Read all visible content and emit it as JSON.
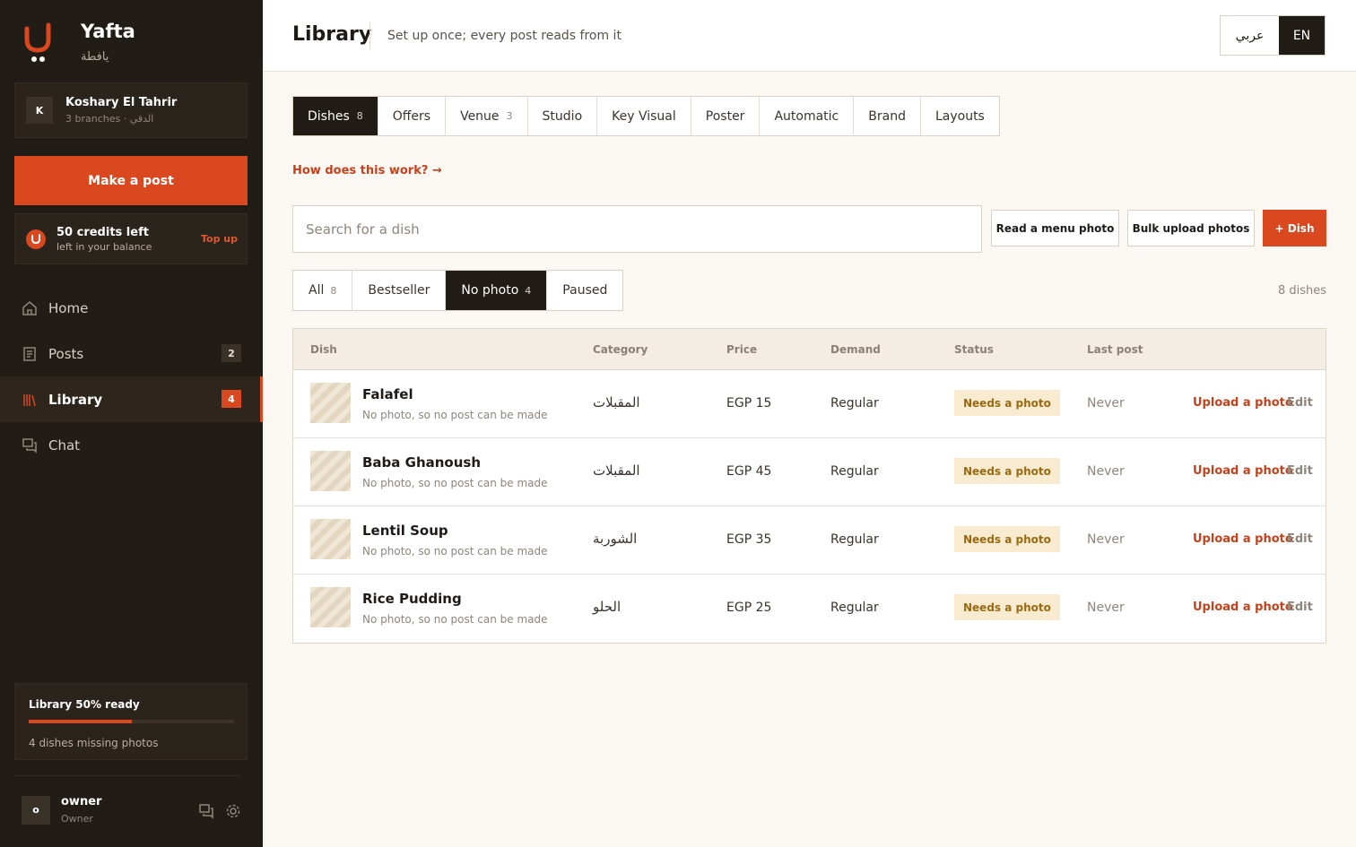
{
  "brand": {
    "name": "Yafta",
    "name_ar": "يافطة"
  },
  "org": {
    "initial": "K",
    "name": "Koshary El Tahrir",
    "sub": "3 branches · الدقي"
  },
  "sidebar": {
    "make_post": "Make a post",
    "credits": {
      "title": "50 credits left",
      "sub": "left in your balance",
      "topup": "Top up"
    },
    "nav": [
      {
        "label": "Home",
        "icon": "home-icon",
        "badge": ""
      },
      {
        "label": "Posts",
        "icon": "posts-icon",
        "badge": "2"
      },
      {
        "label": "Library",
        "icon": "library-icon",
        "badge": "4",
        "active": true
      },
      {
        "label": "Chat",
        "icon": "chat-icon",
        "badge": ""
      }
    ],
    "progress": {
      "title": "Library 50% ready",
      "fraction": 0.5,
      "sub": "4 dishes missing photos"
    },
    "user": {
      "initial": "o",
      "name": "owner",
      "role": "Owner"
    }
  },
  "header": {
    "title": "Library",
    "subtitle": "Set up once; every post reads from it",
    "lang_ar": "عربي",
    "lang_en": "EN"
  },
  "tabs": [
    {
      "label": "Dishes",
      "count": "8",
      "active": true
    },
    {
      "label": "Offers",
      "count": ""
    },
    {
      "label": "Venue",
      "count": "3"
    },
    {
      "label": "Studio",
      "count": ""
    },
    {
      "label": "Key Visual",
      "count": ""
    },
    {
      "label": "Poster",
      "count": ""
    },
    {
      "label": "Automatic",
      "count": ""
    },
    {
      "label": "Brand",
      "count": ""
    },
    {
      "label": "Layouts",
      "count": ""
    }
  ],
  "how_link": "How does this work? →",
  "search": {
    "placeholder": "Search for a dish"
  },
  "actions": {
    "read_menu": "Read a menu photo",
    "bulk_upload": "Bulk upload photos",
    "add_dish": "+ Dish"
  },
  "filters": [
    {
      "label": "All",
      "count": "8"
    },
    {
      "label": "Bestseller",
      "count": ""
    },
    {
      "label": "No photo",
      "count": "4",
      "active": true
    },
    {
      "label": "Paused",
      "count": ""
    }
  ],
  "dish_count": "8 dishes",
  "table": {
    "headers": {
      "dish": "Dish",
      "category": "Category",
      "price": "Price",
      "demand": "Demand",
      "status": "Status",
      "last_post": "Last post"
    },
    "rows": [
      {
        "name": "Falafel",
        "sub": "No photo, so no post can be made",
        "category": "المقبلات",
        "price": "EGP 15",
        "demand": "Regular",
        "status": "Needs a photo",
        "last_post": "Never",
        "upload": "Upload a photo",
        "edit": "Edit"
      },
      {
        "name": "Baba Ghanoush",
        "sub": "No photo, so no post can be made",
        "category": "المقبلات",
        "price": "EGP 45",
        "demand": "Regular",
        "status": "Needs a photo",
        "last_post": "Never",
        "upload": "Upload a photo",
        "edit": "Edit"
      },
      {
        "name": "Lentil Soup",
        "sub": "No photo, so no post can be made",
        "category": "الشوربة",
        "price": "EGP 35",
        "demand": "Regular",
        "status": "Needs a photo",
        "last_post": "Never",
        "upload": "Upload a photo",
        "edit": "Edit"
      },
      {
        "name": "Rice Pudding",
        "sub": "No photo, so no post can be made",
        "category": "الحلو",
        "price": "EGP 25",
        "demand": "Regular",
        "status": "Needs a photo",
        "last_post": "Never",
        "upload": "Upload a photo",
        "edit": "Edit"
      }
    ]
  },
  "colors": {
    "accent": "#d9481f",
    "sidebar_bg": "#221c16",
    "badge_bg": "#f8ebcf",
    "badge_text": "#9a6a12"
  }
}
